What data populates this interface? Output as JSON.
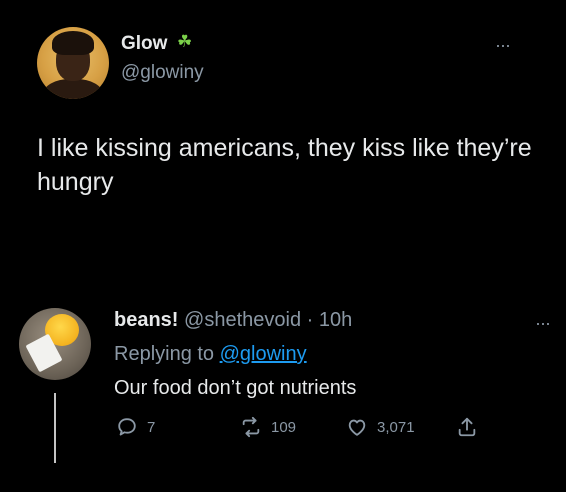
{
  "tweet": {
    "author_name": "Glow",
    "badge_icon": "bug-icon",
    "handle": "@glowiny",
    "text": "I like kissing americans, they kiss like they’re hungry",
    "more_icon": "more-icon"
  },
  "reply": {
    "author_name": "beans!",
    "meta": "@shethevoid · 10h",
    "replying_prefix": "Replying to",
    "replying_mention": "@glowiny",
    "text": "Our food don’t got nutrients",
    "actions": {
      "reply_count": "7",
      "retweet_count": "109",
      "like_count": "3,071"
    }
  },
  "colors": {
    "background": "#000000",
    "text": "#e7e9ea",
    "muted": "#8b98a5",
    "link": "#1d9bf0",
    "badge": "#7bd14a"
  }
}
